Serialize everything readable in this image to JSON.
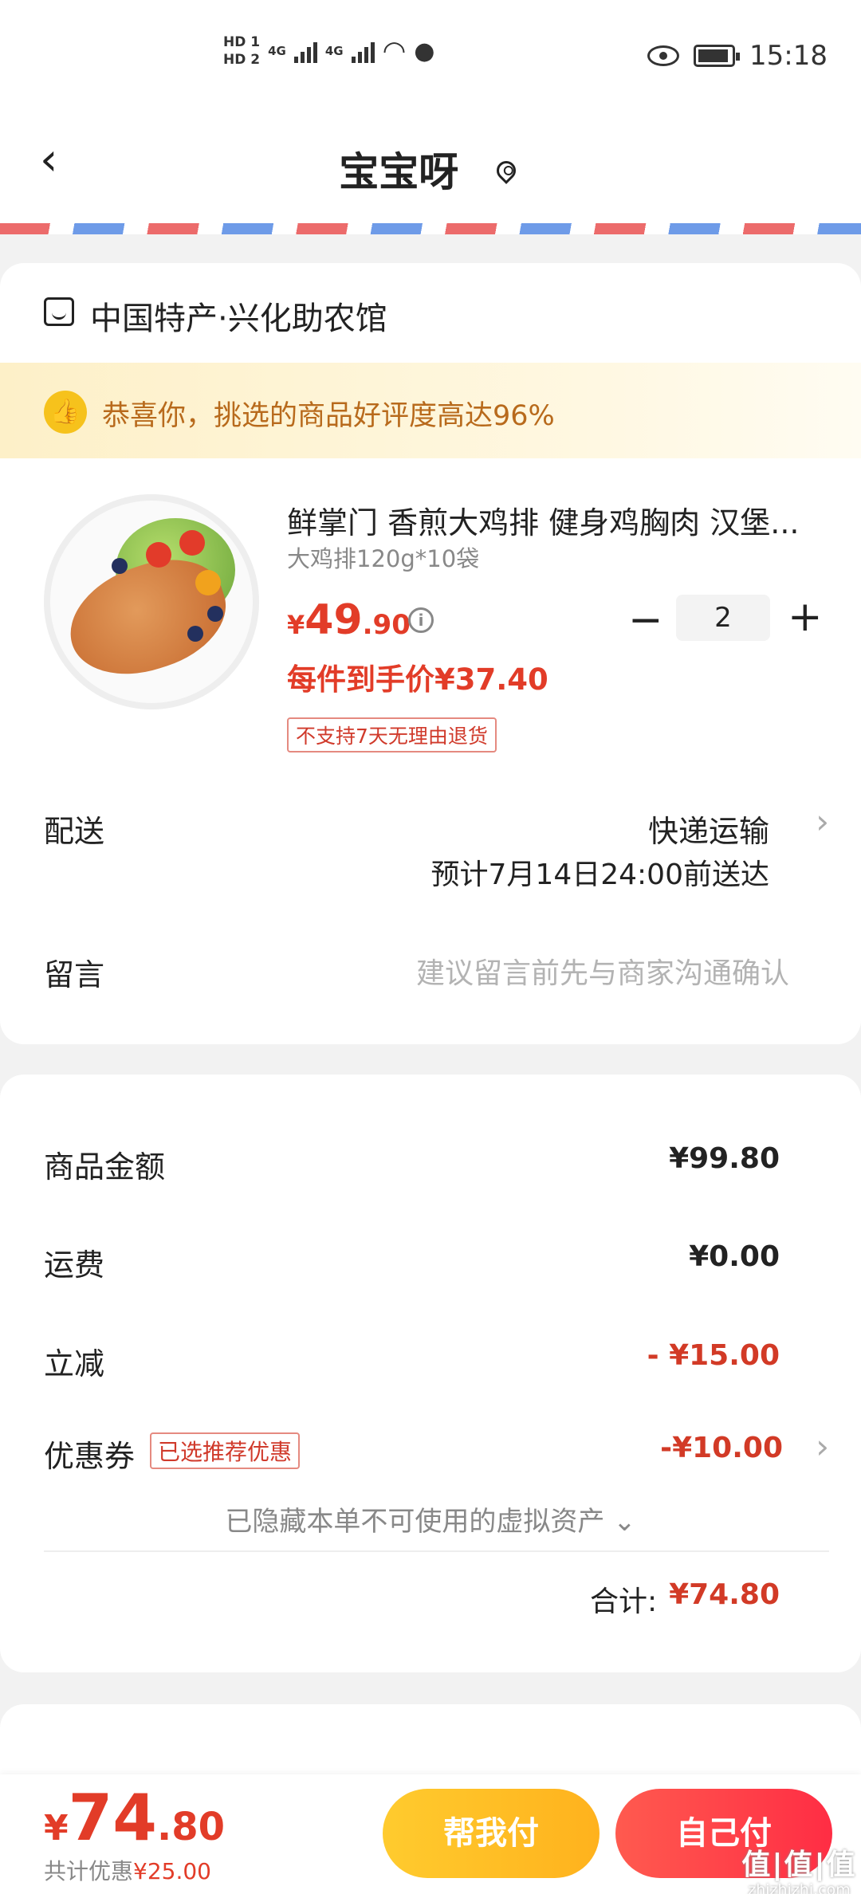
{
  "status_bar": {
    "hd1": "HD 1",
    "hd2": "HD 2",
    "net1": "4G",
    "net2": "4G",
    "time": "15:18"
  },
  "nav": {
    "back_icon": "chevron-left-icon",
    "title": "宝宝呀",
    "location_icon": "location-pin-icon"
  },
  "shop": {
    "icon": "shop-icon",
    "name": "中国特产·兴化助农馆"
  },
  "banner": {
    "icon": "thumbs-up-icon",
    "text": "恭喜你，挑选的商品好评度高达96%"
  },
  "product": {
    "title": "鲜掌门 香煎大鸡排 健身鸡胸肉 汉堡...",
    "spec": "大鸡排120g*10袋",
    "price_currency": "¥",
    "price_int": "49",
    "price_dec": ".90",
    "quantity": "2",
    "minus": "−",
    "plus": "+",
    "unit_price": "每件到手价¥37.40",
    "return_policy": "不支持7天无理由退货"
  },
  "delivery": {
    "label": "配送",
    "method": "快递运输",
    "eta": "预计7月14日24:00前送达",
    "chevron": "›"
  },
  "message": {
    "label": "留言",
    "placeholder": "建议留言前先与商家沟通确认"
  },
  "summary": {
    "goods_label": "商品金额",
    "goods_value": "¥99.80",
    "shipping_label": "运费",
    "shipping_value": "¥0.00",
    "discount_label": "立减",
    "discount_value": "- ¥15.00",
    "coupon_label": "优惠券",
    "coupon_tag": "已选推荐优惠",
    "coupon_value": "-¥10.00",
    "hidden_assets": "已隐藏本单不可使用的虚拟资产 ⌄",
    "total_label": "合计:",
    "total_value": "¥74.80"
  },
  "bottom_bar": {
    "total_currency": "¥",
    "total_int": "74",
    "total_dec": ".80",
    "saved_label": "共计优惠",
    "saved_value": "¥25.00",
    "help_pay": "帮我付",
    "self_pay": "自己付"
  },
  "watermark": {
    "logo": "值|值|值",
    "site": "zhizhizhi.com"
  },
  "colors": {
    "accent_red": "#e23c28",
    "accent_yellow": "#ffbf25",
    "pay_red": "#ff3a45"
  }
}
